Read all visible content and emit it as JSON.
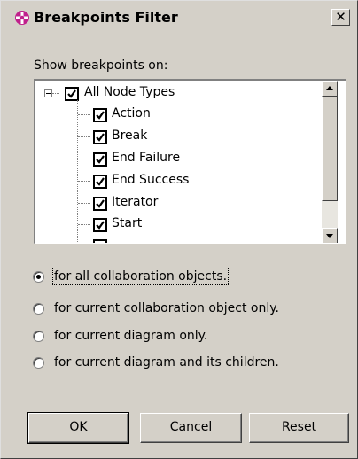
{
  "dialog": {
    "title": "Breakpoints Filter",
    "close_glyph": "✕",
    "title_icon": "breakpoint-filter-icon"
  },
  "filter": {
    "show_label": "Show breakpoints on:",
    "tree": {
      "root": {
        "label": "All Node Types",
        "checked": true,
        "expanded": true
      },
      "children": [
        {
          "label": "Action",
          "checked": true
        },
        {
          "label": "Break",
          "checked": true
        },
        {
          "label": "End Failure",
          "checked": true
        },
        {
          "label": "End Success",
          "checked": true
        },
        {
          "label": "Iterator",
          "checked": true
        },
        {
          "label": "Start",
          "checked": true
        }
      ]
    }
  },
  "scope": {
    "options": [
      {
        "label": "for all collaboration objects.",
        "selected": true
      },
      {
        "label": "for current collaboration object only.",
        "selected": false
      },
      {
        "label": "for current diagram only.",
        "selected": false
      },
      {
        "label": "for current diagram and its children.",
        "selected": false
      }
    ]
  },
  "buttons": {
    "ok": "OK",
    "cancel": "Cancel",
    "reset": "Reset"
  },
  "colors": {
    "dialog_bg": "#d4d0c8",
    "title_icon": "#c0208c"
  }
}
